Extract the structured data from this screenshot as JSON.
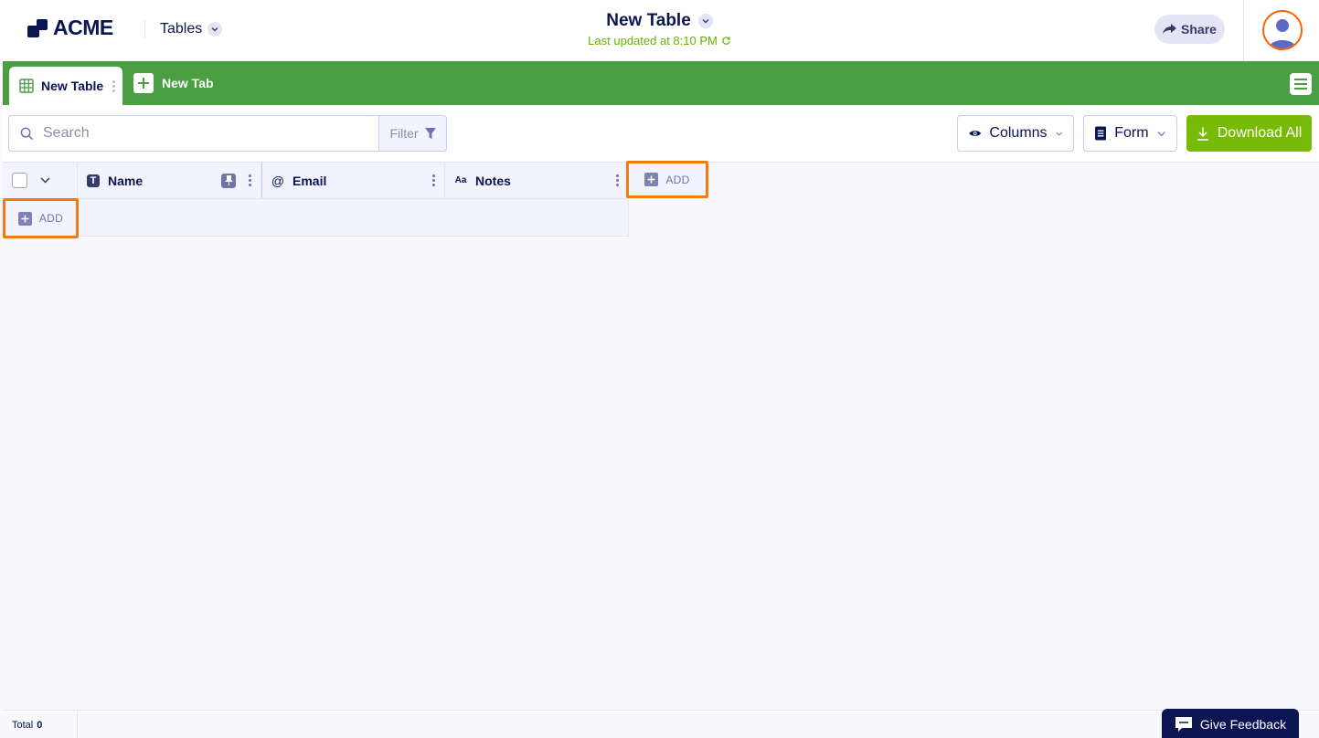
{
  "header": {
    "logo_text": "ACME",
    "app_menu_label": "Tables",
    "table_title": "New Table",
    "last_updated": "Last updated at 8:10 PM",
    "share_label": "Share"
  },
  "tabs": {
    "items": [
      {
        "label": "New Table",
        "active": true
      }
    ],
    "new_tab_label": "New Tab"
  },
  "toolbar": {
    "search_placeholder": "Search",
    "filter_label": "Filter",
    "columns_label": "Columns",
    "form_label": "Form",
    "download_label": "Download All"
  },
  "grid": {
    "columns": [
      {
        "label": "Name",
        "type_icon": "text-type-icon",
        "pinned": true
      },
      {
        "label": "Email",
        "type_icon": "at-sign-icon"
      },
      {
        "label": "Notes",
        "type_icon": "aa-type-icon"
      }
    ],
    "add_column_label": "ADD",
    "add_row_label": "ADD"
  },
  "footer": {
    "total_label": "Total",
    "total_count": "0",
    "feedback_label": "Give Feedback"
  },
  "colors": {
    "brand_navy": "#0a1551",
    "tab_bar_green": "#4a9f43",
    "download_green": "#78bb07",
    "status_green": "#64b200",
    "highlight_orange": "#f07c10",
    "avatar_ring": "#ff6100"
  }
}
